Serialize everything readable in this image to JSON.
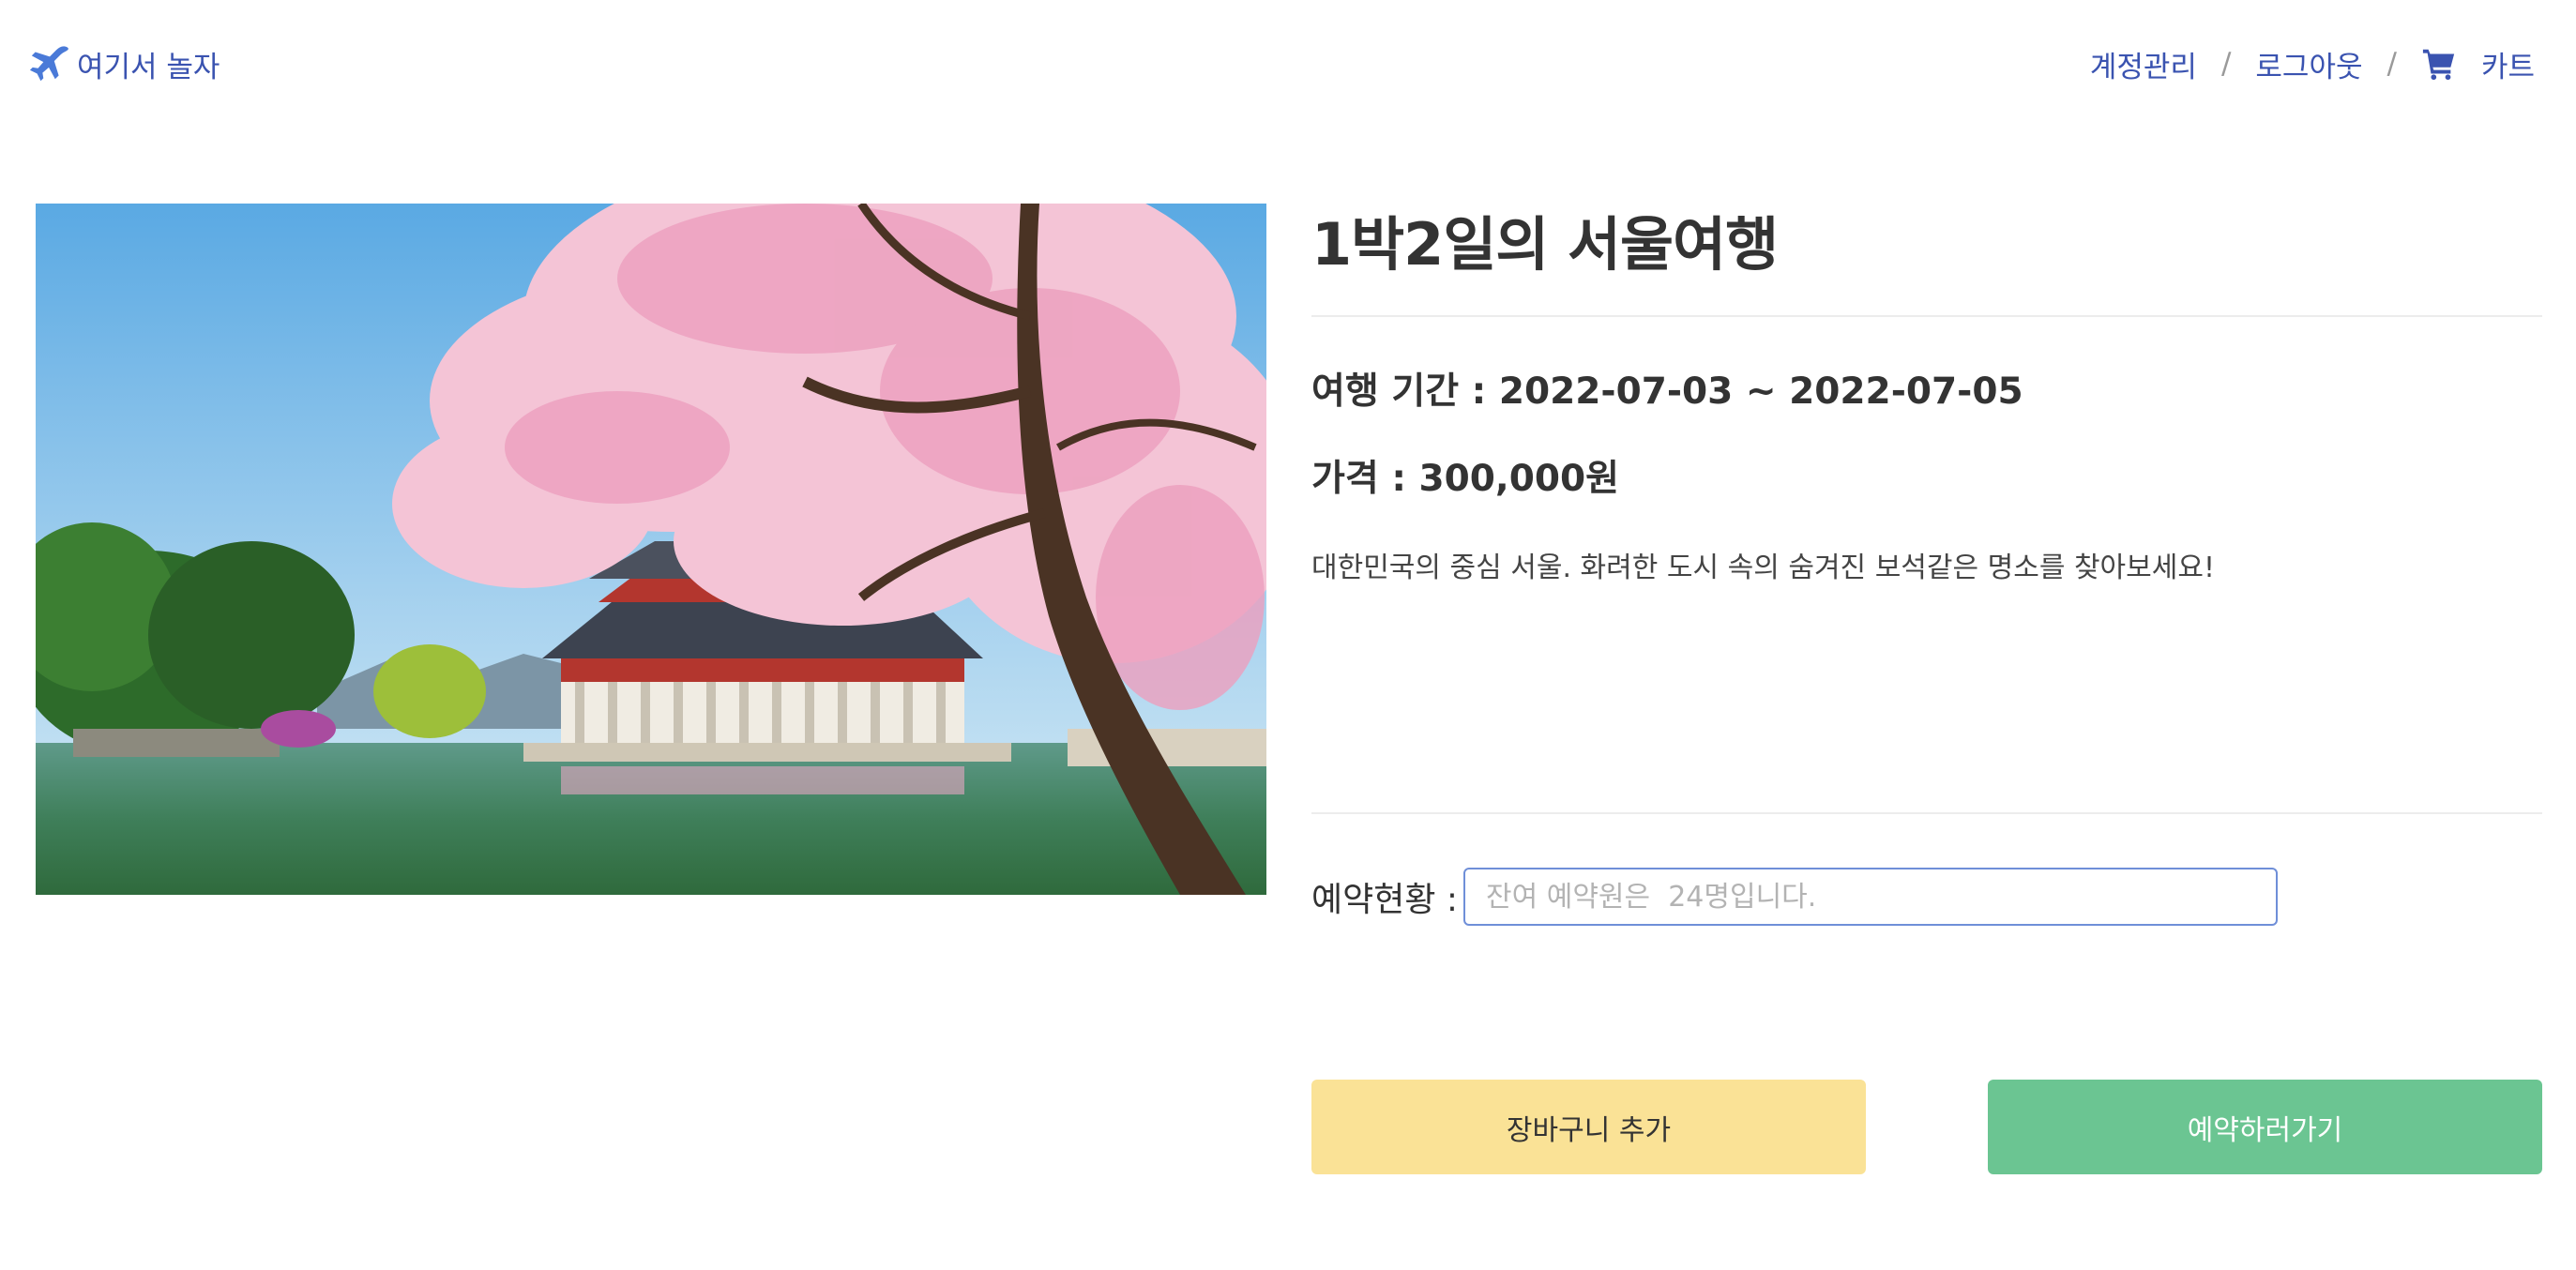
{
  "navbar": {
    "brand_icon": "airplane-icon",
    "brand_label": "여기서 놀자",
    "links": {
      "account": "계정관리",
      "logout": "로그아웃",
      "cart_icon": "shopping-cart-icon",
      "cart": "카트",
      "separator": "/"
    },
    "accent_color": "#3a53b0"
  },
  "product": {
    "title": "1박2일의 서울여행",
    "period": "여행 기간 : 2022-07-03 ~ 2022-07-05",
    "price": "가격 : 300,000원",
    "description": "대한민국의 중심 서울. 화려한 도시 속의 숨겨진 보석같은 명소를 찾아보세요!",
    "image": "seoul-palace-cherry-blossom-photo"
  },
  "reservation": {
    "label": "예약현황 :",
    "value": "",
    "placeholder": "잔여 예약원은  24명입니다."
  },
  "buttons": {
    "add_to_cart": "장바구니 추가",
    "add_to_cart_color": "#fae296",
    "reserve": "예약하러가기",
    "reserve_color": "#6bc592"
  }
}
